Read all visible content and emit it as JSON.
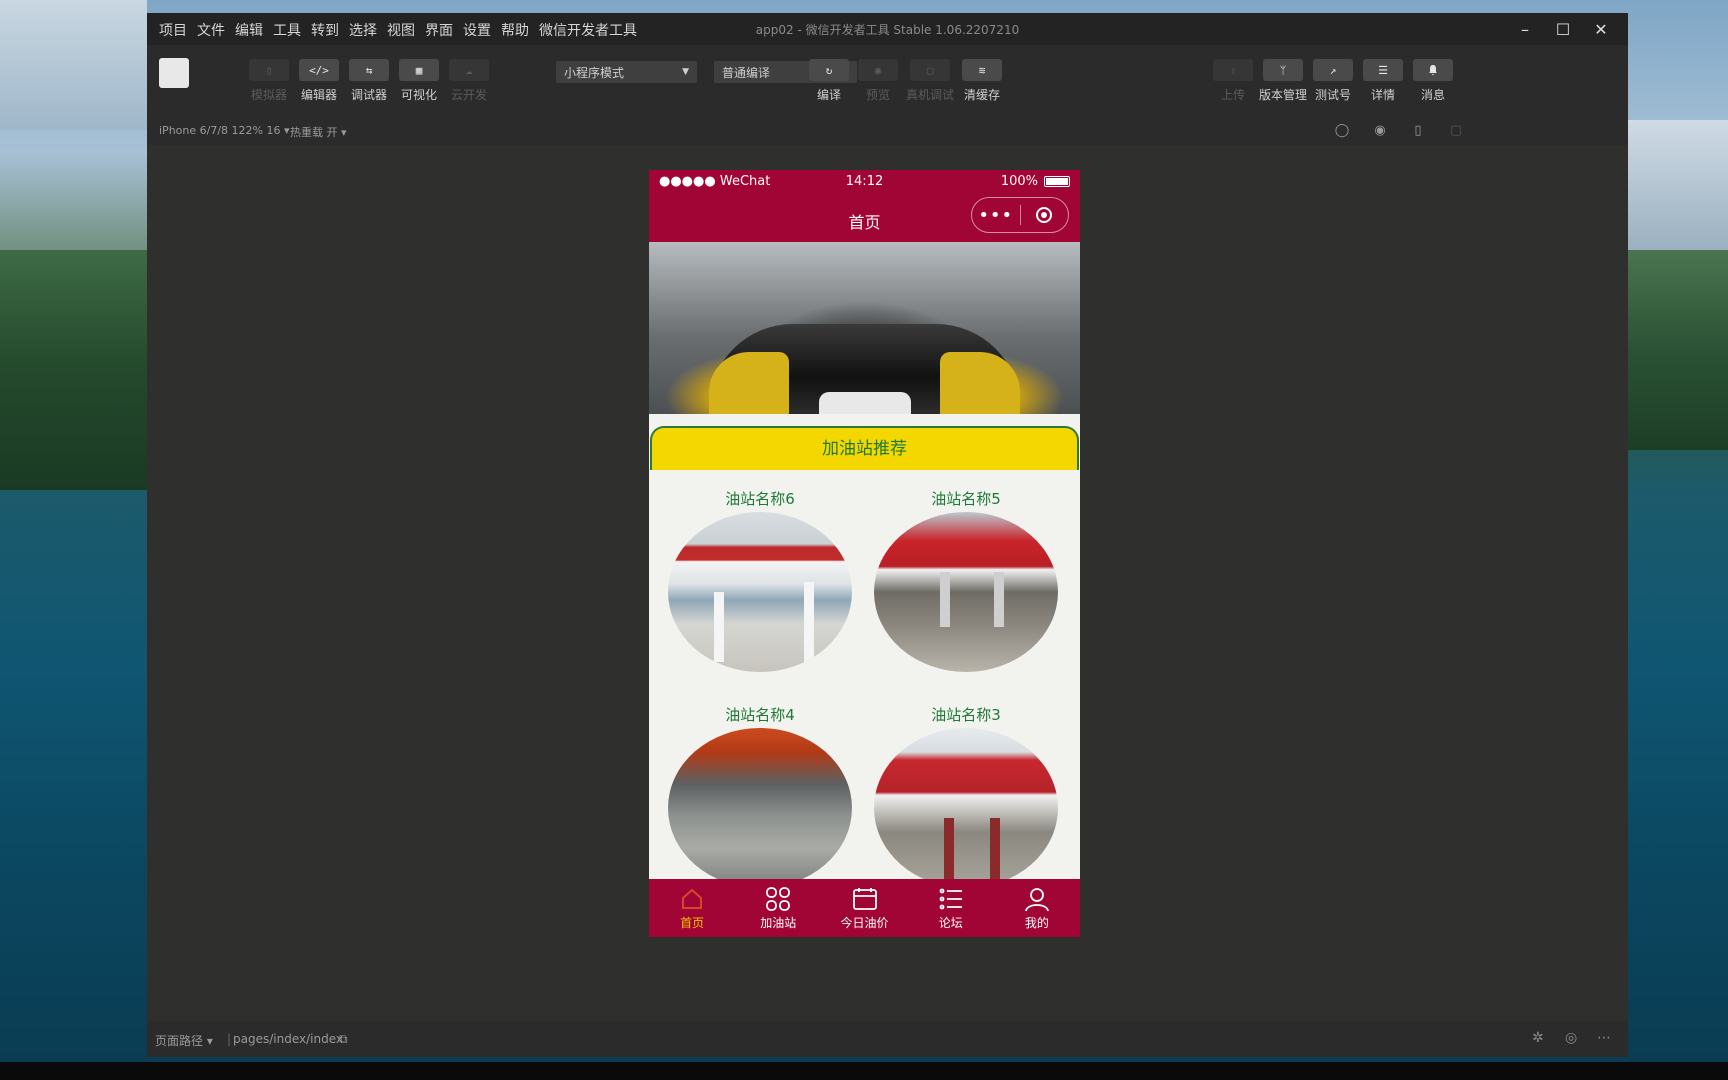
{
  "window": {
    "title": "app02 - 微信开发者工具 Stable 1.06.2207210",
    "menu": [
      "项目",
      "文件",
      "编辑",
      "工具",
      "转到",
      "选择",
      "视图",
      "界面",
      "设置",
      "帮助",
      "微信开发者工具"
    ],
    "controls": [
      "–",
      "☐",
      "✕"
    ]
  },
  "toolbar": {
    "left_buttons": [
      {
        "label": "模拟器",
        "icon": "simulator-icon",
        "glyph": "▯",
        "active": true,
        "dim": true
      },
      {
        "label": "编辑器",
        "icon": "code-icon",
        "glyph": "</>",
        "active": false,
        "dim": false
      },
      {
        "label": "调试器",
        "icon": "debug-icon",
        "glyph": "⇆",
        "active": false,
        "dim": false
      },
      {
        "label": "可视化",
        "icon": "layout-icon",
        "glyph": "▦",
        "active": false,
        "dim": false
      },
      {
        "label": "云开发",
        "icon": "cloud-icon",
        "glyph": "☁",
        "active": false,
        "dim": true
      }
    ],
    "mode_select": "小程序模式",
    "compile_select": "普通编译",
    "mid_buttons": [
      {
        "label": "编译",
        "icon": "refresh-icon",
        "glyph": "↻",
        "dim": false
      },
      {
        "label": "预览",
        "icon": "eye-icon",
        "glyph": "◉",
        "dim": true
      },
      {
        "label": "真机调试",
        "icon": "phone-debug-icon",
        "glyph": "▢",
        "dim": true
      },
      {
        "label": "清缓存",
        "icon": "layers-icon",
        "glyph": "≋",
        "dim": false
      }
    ],
    "right_buttons": [
      {
        "label": "上传",
        "icon": "upload-icon",
        "glyph": "⇧",
        "dim": true
      },
      {
        "label": "版本管理",
        "icon": "branch-icon",
        "glyph": "ᛘ",
        "dim": false
      },
      {
        "label": "测试号",
        "icon": "external-icon",
        "glyph": "↗",
        "dim": false
      },
      {
        "label": "详情",
        "icon": "menu-icon",
        "glyph": "☰",
        "dim": false
      },
      {
        "label": "消息",
        "icon": "bell-icon",
        "glyph": "🔔",
        "dim": false
      }
    ]
  },
  "subbar": {
    "device": "iPhone 6/7/8 122% 16 ▾",
    "hotreload": "热重载 开 ▾"
  },
  "phone": {
    "status_left": "●●●●● WeChat",
    "time": "14:12",
    "battery": "100%",
    "nav_title": "首页",
    "capsule_dots": "•••",
    "section_title": "加油站推荐",
    "stations": [
      {
        "name": "油站名称6"
      },
      {
        "name": "油站名称5"
      },
      {
        "name": "油站名称4"
      },
      {
        "name": "油站名称3"
      }
    ],
    "tabs": [
      {
        "label": "首页",
        "icon": "home-icon",
        "active": true
      },
      {
        "label": "加油站",
        "icon": "grid-icon",
        "active": false
      },
      {
        "label": "今日油价",
        "icon": "calendar-icon",
        "active": false
      },
      {
        "label": "论坛",
        "icon": "list-icon",
        "active": false
      },
      {
        "label": "我的",
        "icon": "user-icon",
        "active": false
      }
    ]
  },
  "statusbar": {
    "path_label": "页面路径 ▾",
    "path": "pages/index/index"
  },
  "colors": {
    "brand": "#a10535",
    "section_bg": "#f5d700",
    "station_text": "#1f7a3a",
    "active_tab": "#f5c400"
  }
}
